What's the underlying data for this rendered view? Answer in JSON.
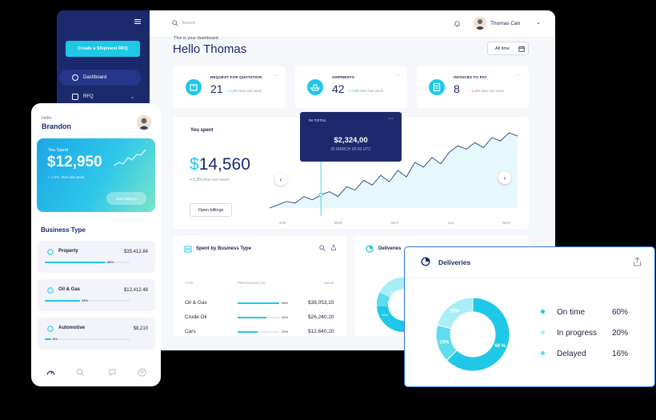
{
  "dashboard": {
    "sidebar": {
      "cta_label": "Create a Shipment RFQ",
      "items": [
        {
          "label": "Dashboard",
          "active": true
        },
        {
          "label": "RFQ",
          "active": false
        }
      ]
    },
    "topbar": {
      "search_placeholder": "Search",
      "user_name": "Thomas Can"
    },
    "subtitle": "This is your dashboard",
    "greeting": "Hello Thomas",
    "period_select": "All time",
    "kpis": [
      {
        "label": "REQUEST FOR QUOTATION",
        "value": "21",
        "delta": "+ 1,2%",
        "delta_note": "than last week",
        "delta_color": "#2bb673"
      },
      {
        "label": "SHIPMENTS",
        "value": "42",
        "delta": "+ 7,4%",
        "delta_note": "than last week",
        "delta_color": "#2bb673"
      },
      {
        "label": "INVOICES TO PAY",
        "value": "8",
        "delta": "- 1,2%",
        "delta_note": "than last week",
        "delta_color": "#e8505b"
      }
    ],
    "spent": {
      "label": "You spent",
      "currency": "$",
      "value": "14,560",
      "delta": "+ 1,2%",
      "delta_note": "than last week",
      "button": "Open billings"
    },
    "tooltip": {
      "header": "IN TOTAL",
      "value": "$2,324,00",
      "date": "25 MARCH 00:00 UTC"
    },
    "chart_data": {
      "type": "line",
      "x": [
        "JAN",
        "MAR",
        "MAY",
        "JUL",
        "NOV"
      ],
      "series": [
        {
          "values": [
            2,
            4,
            6,
            5,
            9,
            7,
            10,
            12,
            9,
            15,
            13,
            19,
            16,
            22,
            18,
            25,
            21,
            30,
            27,
            33,
            29,
            36,
            40,
            38,
            42,
            39,
            45,
            43,
            48,
            46
          ]
        }
      ],
      "grid": true
    },
    "spend_by_type": {
      "title": "Spent by Business Type",
      "columns": [
        "TYPE",
        "PERCENTAGE (%)",
        "VALUE"
      ],
      "rows": [
        {
          "type": "Oil & Gas",
          "pct": "46%",
          "fraction": 0.46,
          "value": "$38,053,15"
        },
        {
          "type": "Crude Oil",
          "pct": "32%",
          "fraction": 0.32,
          "value": "$26,240,20"
        },
        {
          "type": "Cars",
          "pct": "22%",
          "fraction": 0.22,
          "value": "$12,640,20"
        }
      ]
    },
    "deliveries_card": {
      "title": "Deliveries",
      "labels": [
        "20%",
        "16%"
      ]
    }
  },
  "mobile": {
    "hello": "Hello",
    "name": "Brandon",
    "spent_label": "You Spent",
    "spent_value": "$12,950",
    "spent_delta": "+ 1,2%",
    "spent_delta_note": "than last week",
    "see_billings": "Seen billings",
    "business_type_title": "Business Type",
    "items": [
      {
        "label": "Property",
        "value": "$35,412.84",
        "pct": "88%",
        "fraction": 0.72,
        "icon": "home-icon"
      },
      {
        "label": "Oil & Gas",
        "value": "$12,412.48",
        "pct": "33%",
        "fraction": 0.42,
        "icon": "oil-icon"
      },
      {
        "label": "Automotive",
        "value": "$8,210",
        "pct": "8%",
        "fraction": 0.08,
        "icon": "car-icon"
      }
    ],
    "nav": [
      "dashboard-icon",
      "search-icon",
      "chat-icon",
      "profile-icon"
    ]
  },
  "deliveries": {
    "title": "Deliveries",
    "segments": [
      {
        "name": "On time",
        "pct": "60%",
        "value": 60,
        "color": "#1fc8e6"
      },
      {
        "name": "In progress",
        "pct": "20%",
        "value": 20,
        "color": "#a8eef6"
      },
      {
        "name": "Delayed",
        "pct": "16%",
        "value": 16,
        "color": "#5fdcef"
      }
    ],
    "donut_labels": [
      "60 %",
      "20%",
      "16%"
    ]
  },
  "colors": {
    "accent": "#1fc8e6",
    "navy": "#1b2a6d",
    "positive": "#2bb673",
    "negative": "#e8505b"
  }
}
